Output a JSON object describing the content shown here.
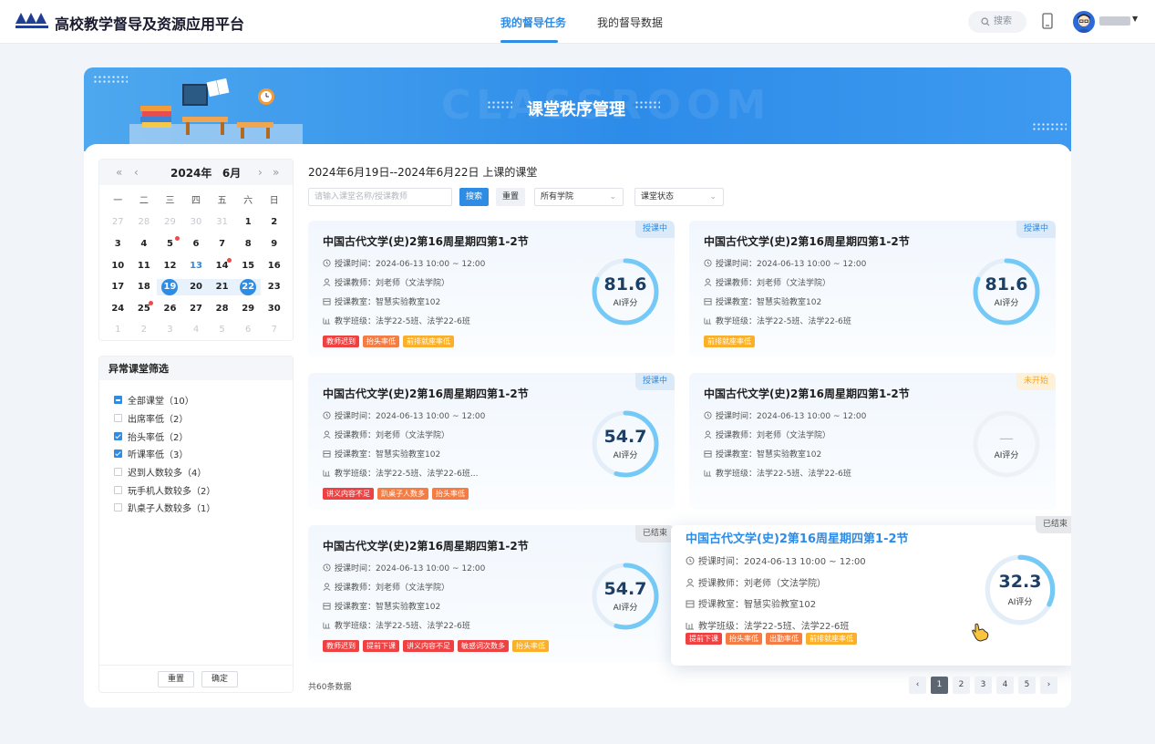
{
  "header": {
    "app_title": "高校教学督导及资源应用平台",
    "tabs": [
      "我的督导任务",
      "我的督导数据"
    ],
    "search_label": "搜索"
  },
  "banner": {
    "title": "课堂秩序管理",
    "watermark": "CLASSROOM"
  },
  "calendar": {
    "year_label": "2024年",
    "month_label": "6月",
    "nav_prev_year": "«",
    "nav_prev_month": "‹",
    "nav_next_month": "›",
    "nav_next_year": "»",
    "weekdays": [
      "一",
      "二",
      "三",
      "四",
      "五",
      "六",
      "日"
    ],
    "rows": [
      [
        "27",
        "28",
        "29",
        "30",
        "31",
        "1",
        "2"
      ],
      [
        "3",
        "4",
        "5",
        "6",
        "7",
        "8",
        "9"
      ],
      [
        "10",
        "11",
        "12",
        "13",
        "14",
        "15",
        "16"
      ],
      [
        "17",
        "18",
        "19",
        "20",
        "21",
        "22",
        "23"
      ],
      [
        "24",
        "25",
        "26",
        "27",
        "28",
        "29",
        "30"
      ],
      [
        "1",
        "2",
        "3",
        "4",
        "5",
        "6",
        "7"
      ]
    ]
  },
  "filter": {
    "title": "异常课堂筛选",
    "items": [
      "全部课堂（10）",
      "出席率低（2）",
      "抬头率低（2）",
      "听课率低（3）",
      "迟到人数较多（4）",
      "玩手机人数较多（2）",
      "趴桌子人数较多（1）"
    ],
    "reset": "重置",
    "confirm": "确定"
  },
  "toolbar": {
    "range_title": "2024年6月19日--2024年6月22日 上课的课堂",
    "search_placeholder": "请输入课堂名称/授课教师",
    "search_btn": "搜索",
    "reset_btn": "重置",
    "college_select": "所有学院",
    "status_select": "课堂状态"
  },
  "cards": [
    {
      "title": "中国古代文学(史)2第16周星期四第1-2节",
      "status": "授课中",
      "time": "授课时间：2024-06-13 10:00 ~ 12:00",
      "teacher": "授课教师：刘老师（文法学院）",
      "room": "授课教室：智慧实验教室102",
      "classes": "教学班级：法学22-5班、法学22-6班",
      "score": "81.6",
      "score_value": 81.6,
      "score_label": "AI评分",
      "tags": [
        "教师迟到",
        "抬头率低",
        "前排就座率低"
      ]
    },
    {
      "title": "中国古代文学(史)2第16周星期四第1-2节",
      "status": "授课中",
      "time": "授课时间：2024-06-13 10:00 ~ 12:00",
      "teacher": "授课教师：刘老师（文法学院）",
      "room": "授课教室：智慧实验教室102",
      "classes": "教学班级：法学22-5班、法学22-6班",
      "score": "81.6",
      "score_value": 81.6,
      "score_label": "AI评分",
      "tags": [
        "前排就座率低"
      ]
    },
    {
      "title": "中国古代文学(史)2第16周星期四第1-2节",
      "status": "授课中",
      "time": "授课时间：2024-06-13 10:00 ~ 12:00",
      "teacher": "授课教师：刘老师（文法学院）",
      "room": "授课教室：智慧实验教室102",
      "classes": "教学班级：法学22-5班、法学22-6班...",
      "score": "54.7",
      "score_value": 54.7,
      "score_label": "AI评分",
      "tags": [
        "讲义内容不足",
        "趴桌子人数多",
        "抬头率低"
      ]
    },
    {
      "title": "中国古代文学(史)2第16周星期四第1-2节",
      "status": "未开始",
      "time": "授课时间：2024-06-13 10:00 ~ 12:00",
      "teacher": "授课教师：刘老师（文法学院）",
      "room": "授课教室：智慧实验教室102",
      "classes": "教学班级：法学22-5班、法学22-6班",
      "score": "—",
      "score_value": 0,
      "score_label": "AI评分",
      "tags": []
    },
    {
      "title": "中国古代文学(史)2第16周星期四第1-2节",
      "status": "已结束",
      "time": "授课时间：2024-06-13 10:00 ~ 12:00",
      "teacher": "授课教师：刘老师（文法学院）",
      "room": "授课教室：智慧实验教室102",
      "classes": "教学班级：法学22-5班、法学22-6班",
      "score": "54.7",
      "score_value": 54.7,
      "score_label": "AI评分",
      "tags": [
        "教师迟到",
        "提前下课",
        "讲义内容不足",
        "敏感词次数多",
        "抬头率低"
      ]
    },
    {
      "title": "中国古代文学(史)2第16周星期四第1-2节",
      "status": "已结束",
      "time": "授课时间：2024-06-13 10:00 ~ 12:00",
      "teacher": "授课教师：刘老师（文法学院）",
      "room": "授课教室：智慧实验教室102",
      "classes": "教学班级：法学22-5班、法学22-6班",
      "score": "32.3",
      "score_value": 32.3,
      "score_label": "AI评分",
      "tags": [
        "提前下课",
        "抬头率低",
        "出勤率低",
        "前排就座率低"
      ]
    }
  ],
  "footer": {
    "total": "共60条数据",
    "pages": [
      "1",
      "2",
      "3",
      "4",
      "5"
    ],
    "prev": "‹",
    "next": "›"
  },
  "colors": {
    "accent": "#2e8ce5",
    "tag_red": "#ef4141",
    "tag_orange": "#f57d44",
    "tag_amber": "#fbb02b"
  }
}
